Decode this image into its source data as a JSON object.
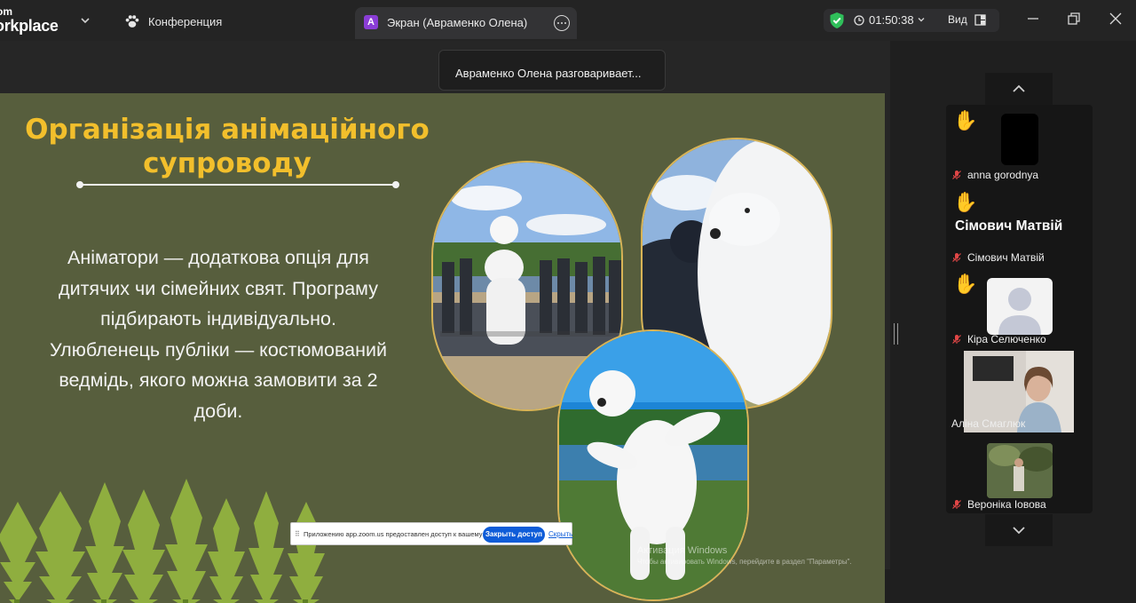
{
  "app": {
    "brand_line1": "om",
    "brand_line2": "orkplace",
    "conference_label": "Конференция"
  },
  "share_tab": {
    "badge": "A",
    "label": "Экран (Авраменко Олена)"
  },
  "status": {
    "timer": "01:50:38",
    "view_label": "Вид"
  },
  "speaking_tooltip": "Авраменко Олена разговаривает...",
  "slide": {
    "title_line1": "Організація анімаційного",
    "title_line2": "супроводу",
    "body_lines": [
      "Аніматори — додаткова опція для",
      "дитячих чи сімейних свят. Програму",
      "підбирають індивідуально.",
      "Улюбленець публіки — костюмований",
      "ведмідь, якого можна замовити за 2",
      "доби."
    ],
    "accent_color": "#f2bf2c",
    "background_color": "#575e3d"
  },
  "windows_watermark": {
    "line1": "Активация Windows",
    "line2": "Чтобы активировать Windows, перейдите в раздел \"Параметры\"."
  },
  "access_bar": {
    "grip": "⠿",
    "message": "Приложению app.zoom.us предоставлен доступ к вашему экрану.",
    "stop_label": "Закрыть доступ",
    "hide_label": "Скрыть"
  },
  "participants": [
    {
      "name": "anna gorodnya",
      "hand_raised": true,
      "muted": true,
      "video": "off-black"
    },
    {
      "name": "Сімович Матвій",
      "display_name": "Сімович Матвій",
      "hand_raised": true,
      "muted": true,
      "video": "off-name"
    },
    {
      "name": "Кіра Селюченко",
      "hand_raised": true,
      "muted": true,
      "video": "avatar"
    },
    {
      "name": "Аліна Смаглюк",
      "hand_raised": false,
      "muted": false,
      "video": "on"
    },
    {
      "name": "Вероніка Іовова",
      "hand_raised": false,
      "muted": true,
      "video": "photo"
    }
  ],
  "icons": {
    "hand": "✋",
    "status_ok_color": "#2fbf5a",
    "muted_color": "#e04646"
  }
}
